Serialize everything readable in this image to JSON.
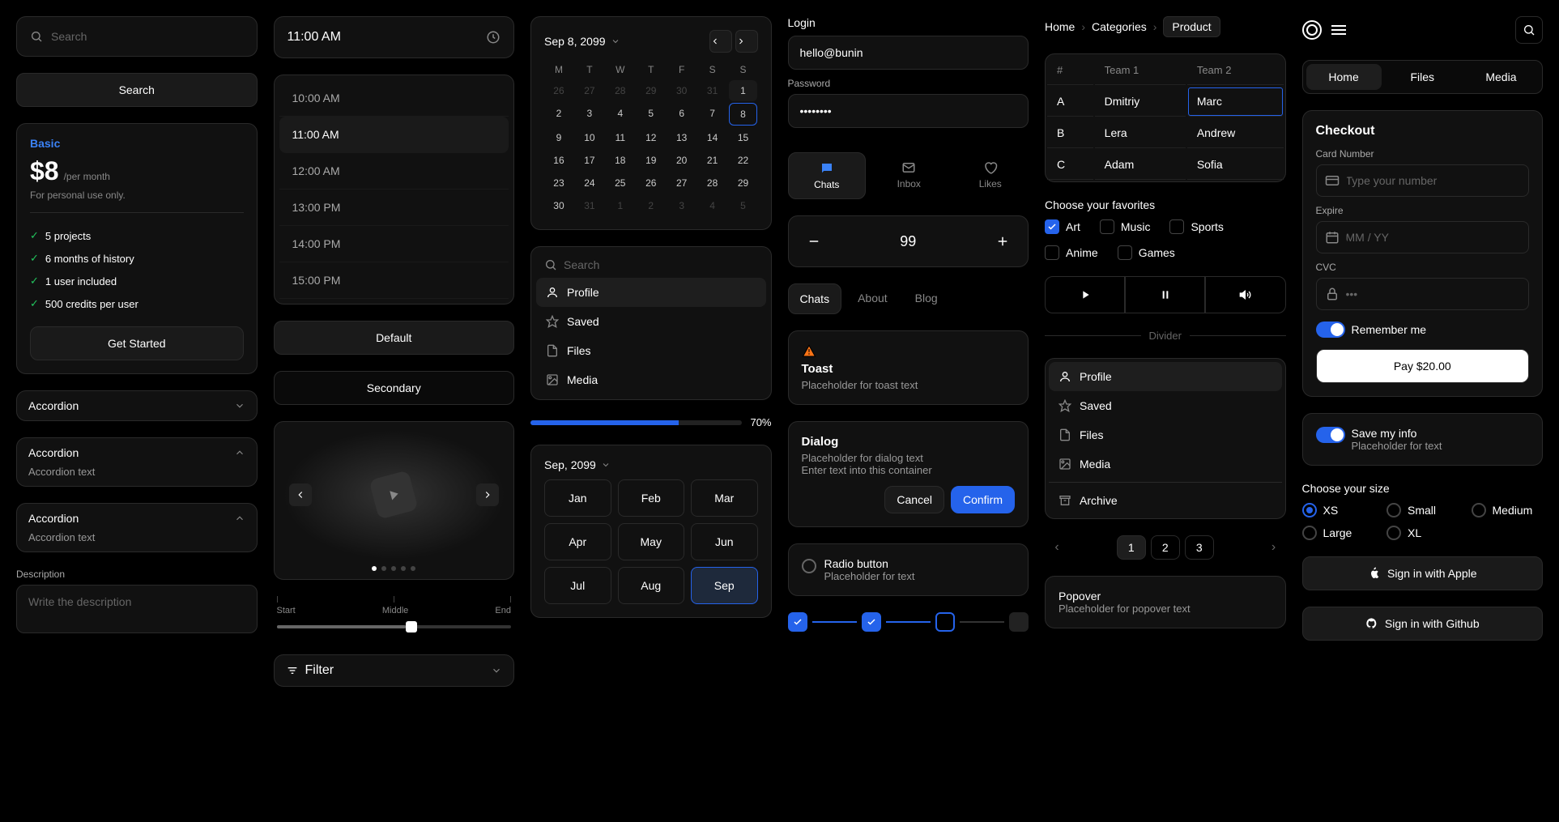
{
  "col1": {
    "search_placeholder": "Search",
    "search_button": "Search",
    "pricing": {
      "plan": "Basic",
      "amount": "$8",
      "per": "/per month",
      "tagline": "For personal use only.",
      "features": [
        "5 projects",
        "6 months of history",
        "1 user included",
        "500 credits per user"
      ],
      "cta": "Get Started"
    },
    "accordions": [
      {
        "title": "Accordion",
        "open": false
      },
      {
        "title": "Accordion",
        "open": true,
        "body": "Accordion text"
      },
      {
        "title": "Accordion",
        "open": true,
        "body": "Accordion text"
      }
    ],
    "description_label": "Description",
    "description_placeholder": "Write the description"
  },
  "col2": {
    "time_value": "11:00 AM",
    "slots": [
      "10:00 AM",
      "11:00 AM",
      "12:00 AM",
      "13:00 PM",
      "14:00 PM",
      "15:00 PM"
    ],
    "active_slot": 1,
    "buttons": {
      "default": "Default",
      "secondary": "Secondary"
    },
    "slider": {
      "start": "Start",
      "middle": "Middle",
      "end": "End"
    },
    "filter": "Filter"
  },
  "col3": {
    "cal": {
      "label": "Sep 8, 2099",
      "dow": [
        "M",
        "T",
        "W",
        "T",
        "F",
        "S",
        "S"
      ],
      "days_pre": [
        26,
        27,
        28,
        29,
        30,
        31
      ],
      "days": [
        1,
        2,
        3,
        4,
        5,
        6,
        7,
        8,
        9,
        10,
        11,
        12,
        13,
        14,
        15,
        16,
        17,
        18,
        19,
        20,
        21,
        22,
        23,
        24,
        25,
        26,
        27,
        28,
        29,
        30
      ],
      "days_post": [
        31,
        1,
        2,
        3,
        4,
        5
      ],
      "selected": 8
    },
    "search_placeholder": "Search",
    "menu": [
      "Profile",
      "Saved",
      "Files",
      "Media"
    ],
    "progress_pct": "70%",
    "month_picker": {
      "label": "Sep, 2099",
      "months": [
        "Jan",
        "Feb",
        "Mar",
        "Apr",
        "May",
        "Jun",
        "Jul",
        "Aug",
        "Sep"
      ],
      "selected": "Sep"
    }
  },
  "col4": {
    "login": {
      "title": "Login",
      "email": "hello@bunin",
      "password_label": "Password",
      "password_mask": "••••••••"
    },
    "tabs_icon": [
      {
        "name": "Chats",
        "icon": "chat"
      },
      {
        "name": "Inbox",
        "icon": "mail"
      },
      {
        "name": "Likes",
        "icon": "heart"
      }
    ],
    "stepper_value": "99",
    "tabs_underline": [
      "Chats",
      "About",
      "Blog"
    ],
    "toast": {
      "title": "Toast",
      "body": "Placeholder for toast text"
    },
    "dialog": {
      "title": "Dialog",
      "body1": "Placeholder for dialog text",
      "body2": "Enter text into this container",
      "cancel": "Cancel",
      "confirm": "Confirm"
    },
    "radio": {
      "title": "Radio button",
      "body": "Placeholder for text"
    }
  },
  "col5": {
    "breadcrumb": [
      "Home",
      "Categories",
      "Product"
    ],
    "table": {
      "headers": [
        "#",
        "Team 1",
        "Team 2"
      ],
      "rows": [
        [
          "A",
          "Dmitriy",
          "Marc"
        ],
        [
          "B",
          "Lera",
          "Andrew"
        ],
        [
          "C",
          "Adam",
          "Sofia"
        ]
      ],
      "selected_cell": [
        0,
        2
      ]
    },
    "fav_label": "Choose your favorites",
    "favs": [
      {
        "label": "Art",
        "checked": true
      },
      {
        "label": "Music",
        "checked": false
      },
      {
        "label": "Sports",
        "checked": false
      },
      {
        "label": "Anime",
        "checked": false
      },
      {
        "label": "Games",
        "checked": false
      }
    ],
    "divider": "Divider",
    "profile_menu": [
      "Profile",
      "Saved",
      "Files",
      "Media",
      "Archive"
    ],
    "pagination": {
      "pages": [
        "1",
        "2",
        "3"
      ],
      "active": 0
    },
    "popover": {
      "title": "Popover",
      "body": "Placeholder for popover text"
    }
  },
  "col6": {
    "seg": [
      "Home",
      "Files",
      "Media"
    ],
    "checkout": {
      "title": "Checkout",
      "card_label": "Card Number",
      "card_placeholder": "Type your number",
      "expire_label": "Expire",
      "expire_placeholder": "MM / YY",
      "cvc_label": "CVC",
      "cvc_placeholder": "•••",
      "remember": "Remember me",
      "pay": "Pay $20.00"
    },
    "save_info": {
      "title": "Save my info",
      "body": "Placeholder for text"
    },
    "size": {
      "label": "Choose your size",
      "options": [
        "XS",
        "Small",
        "Medium",
        "Large",
        "XL"
      ],
      "selected": "XS"
    },
    "apple": "Sign in with Apple",
    "github": "Sign in with Github"
  }
}
